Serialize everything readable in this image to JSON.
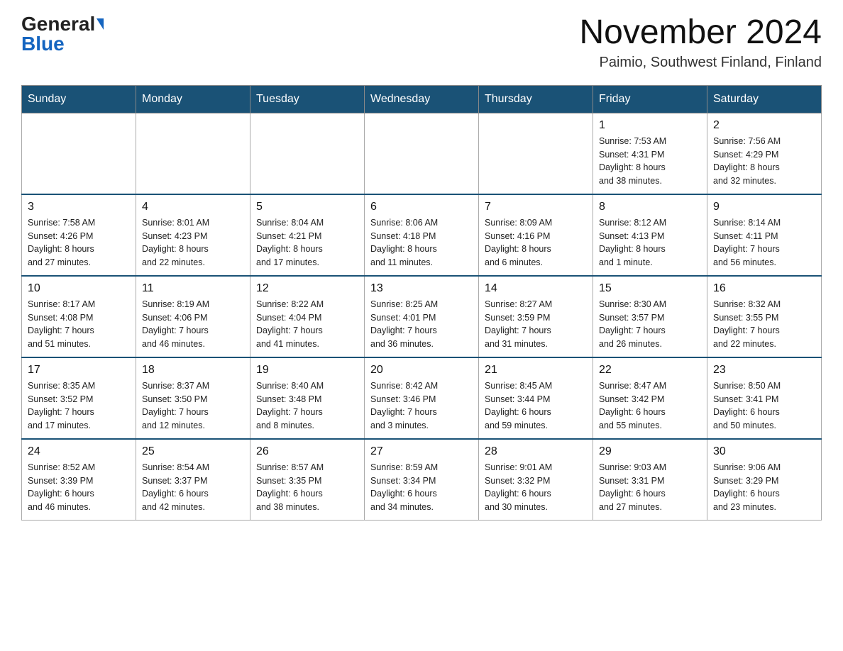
{
  "header": {
    "logo_general": "General",
    "logo_blue": "Blue",
    "month_title": "November 2024",
    "location": "Paimio, Southwest Finland, Finland"
  },
  "weekdays": [
    "Sunday",
    "Monday",
    "Tuesday",
    "Wednesday",
    "Thursday",
    "Friday",
    "Saturday"
  ],
  "weeks": [
    [
      {
        "day": "",
        "info": ""
      },
      {
        "day": "",
        "info": ""
      },
      {
        "day": "",
        "info": ""
      },
      {
        "day": "",
        "info": ""
      },
      {
        "day": "",
        "info": ""
      },
      {
        "day": "1",
        "info": "Sunrise: 7:53 AM\nSunset: 4:31 PM\nDaylight: 8 hours\nand 38 minutes."
      },
      {
        "day": "2",
        "info": "Sunrise: 7:56 AM\nSunset: 4:29 PM\nDaylight: 8 hours\nand 32 minutes."
      }
    ],
    [
      {
        "day": "3",
        "info": "Sunrise: 7:58 AM\nSunset: 4:26 PM\nDaylight: 8 hours\nand 27 minutes."
      },
      {
        "day": "4",
        "info": "Sunrise: 8:01 AM\nSunset: 4:23 PM\nDaylight: 8 hours\nand 22 minutes."
      },
      {
        "day": "5",
        "info": "Sunrise: 8:04 AM\nSunset: 4:21 PM\nDaylight: 8 hours\nand 17 minutes."
      },
      {
        "day": "6",
        "info": "Sunrise: 8:06 AM\nSunset: 4:18 PM\nDaylight: 8 hours\nand 11 minutes."
      },
      {
        "day": "7",
        "info": "Sunrise: 8:09 AM\nSunset: 4:16 PM\nDaylight: 8 hours\nand 6 minutes."
      },
      {
        "day": "8",
        "info": "Sunrise: 8:12 AM\nSunset: 4:13 PM\nDaylight: 8 hours\nand 1 minute."
      },
      {
        "day": "9",
        "info": "Sunrise: 8:14 AM\nSunset: 4:11 PM\nDaylight: 7 hours\nand 56 minutes."
      }
    ],
    [
      {
        "day": "10",
        "info": "Sunrise: 8:17 AM\nSunset: 4:08 PM\nDaylight: 7 hours\nand 51 minutes."
      },
      {
        "day": "11",
        "info": "Sunrise: 8:19 AM\nSunset: 4:06 PM\nDaylight: 7 hours\nand 46 minutes."
      },
      {
        "day": "12",
        "info": "Sunrise: 8:22 AM\nSunset: 4:04 PM\nDaylight: 7 hours\nand 41 minutes."
      },
      {
        "day": "13",
        "info": "Sunrise: 8:25 AM\nSunset: 4:01 PM\nDaylight: 7 hours\nand 36 minutes."
      },
      {
        "day": "14",
        "info": "Sunrise: 8:27 AM\nSunset: 3:59 PM\nDaylight: 7 hours\nand 31 minutes."
      },
      {
        "day": "15",
        "info": "Sunrise: 8:30 AM\nSunset: 3:57 PM\nDaylight: 7 hours\nand 26 minutes."
      },
      {
        "day": "16",
        "info": "Sunrise: 8:32 AM\nSunset: 3:55 PM\nDaylight: 7 hours\nand 22 minutes."
      }
    ],
    [
      {
        "day": "17",
        "info": "Sunrise: 8:35 AM\nSunset: 3:52 PM\nDaylight: 7 hours\nand 17 minutes."
      },
      {
        "day": "18",
        "info": "Sunrise: 8:37 AM\nSunset: 3:50 PM\nDaylight: 7 hours\nand 12 minutes."
      },
      {
        "day": "19",
        "info": "Sunrise: 8:40 AM\nSunset: 3:48 PM\nDaylight: 7 hours\nand 8 minutes."
      },
      {
        "day": "20",
        "info": "Sunrise: 8:42 AM\nSunset: 3:46 PM\nDaylight: 7 hours\nand 3 minutes."
      },
      {
        "day": "21",
        "info": "Sunrise: 8:45 AM\nSunset: 3:44 PM\nDaylight: 6 hours\nand 59 minutes."
      },
      {
        "day": "22",
        "info": "Sunrise: 8:47 AM\nSunset: 3:42 PM\nDaylight: 6 hours\nand 55 minutes."
      },
      {
        "day": "23",
        "info": "Sunrise: 8:50 AM\nSunset: 3:41 PM\nDaylight: 6 hours\nand 50 minutes."
      }
    ],
    [
      {
        "day": "24",
        "info": "Sunrise: 8:52 AM\nSunset: 3:39 PM\nDaylight: 6 hours\nand 46 minutes."
      },
      {
        "day": "25",
        "info": "Sunrise: 8:54 AM\nSunset: 3:37 PM\nDaylight: 6 hours\nand 42 minutes."
      },
      {
        "day": "26",
        "info": "Sunrise: 8:57 AM\nSunset: 3:35 PM\nDaylight: 6 hours\nand 38 minutes."
      },
      {
        "day": "27",
        "info": "Sunrise: 8:59 AM\nSunset: 3:34 PM\nDaylight: 6 hours\nand 34 minutes."
      },
      {
        "day": "28",
        "info": "Sunrise: 9:01 AM\nSunset: 3:32 PM\nDaylight: 6 hours\nand 30 minutes."
      },
      {
        "day": "29",
        "info": "Sunrise: 9:03 AM\nSunset: 3:31 PM\nDaylight: 6 hours\nand 27 minutes."
      },
      {
        "day": "30",
        "info": "Sunrise: 9:06 AM\nSunset: 3:29 PM\nDaylight: 6 hours\nand 23 minutes."
      }
    ]
  ]
}
